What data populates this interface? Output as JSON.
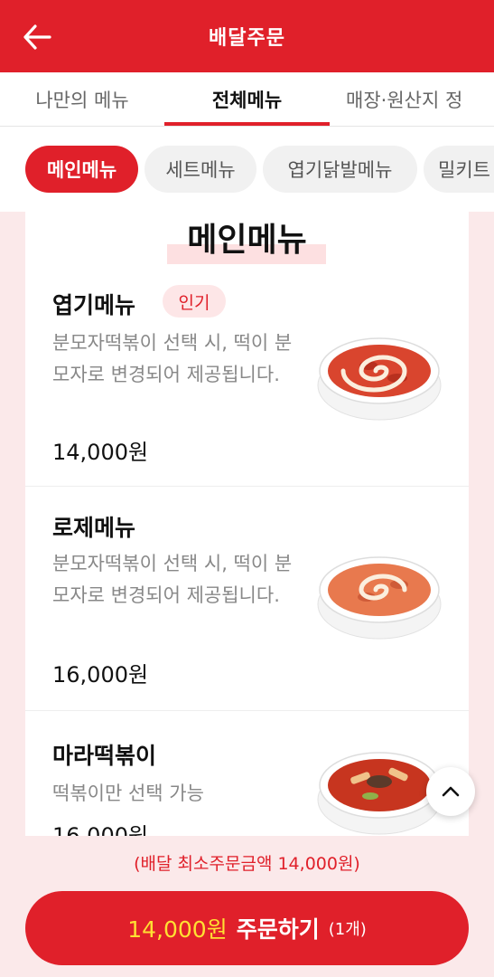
{
  "header": {
    "title": "배달주문",
    "back_icon": "arrow-left-icon"
  },
  "tabs": [
    {
      "label": "나만의 메뉴"
    },
    {
      "label": "전체메뉴"
    },
    {
      "label": "매장·원산지 정"
    }
  ],
  "chips": [
    {
      "label": "메인메뉴"
    },
    {
      "label": "세트메뉴"
    },
    {
      "label": "엽기닭발메뉴"
    },
    {
      "label": "밀키트"
    }
  ],
  "section": {
    "title": "메인메뉴"
  },
  "menu": [
    {
      "name": "엽기메뉴",
      "badge": "인기",
      "desc": "분모자떡볶이 선택 시, 떡이 분모자로 변경되어 제공됩니다.",
      "price": "14,000원"
    },
    {
      "name": "로제메뉴",
      "desc": "분모자떡볶이 선택 시, 떡이 분모자로 변경되어 제공됩니다.",
      "price": "16,000원"
    },
    {
      "name": "마라떡볶이",
      "desc": "떡볶이만 선택 가능",
      "price": "16,000원"
    }
  ],
  "bottom": {
    "min_order": "(배달 최소주문금액 14,000원)",
    "order_price": "14,000원",
    "order_label": "주문하기",
    "order_count": "(1개)"
  },
  "colors": {
    "brand_red": "#e0202a",
    "price_yellow": "#ffe033",
    "badge_bg": "#fde6e7",
    "page_bg": "#fbe9ea"
  },
  "icons": {
    "scroll_top": "chevron-up-icon"
  }
}
